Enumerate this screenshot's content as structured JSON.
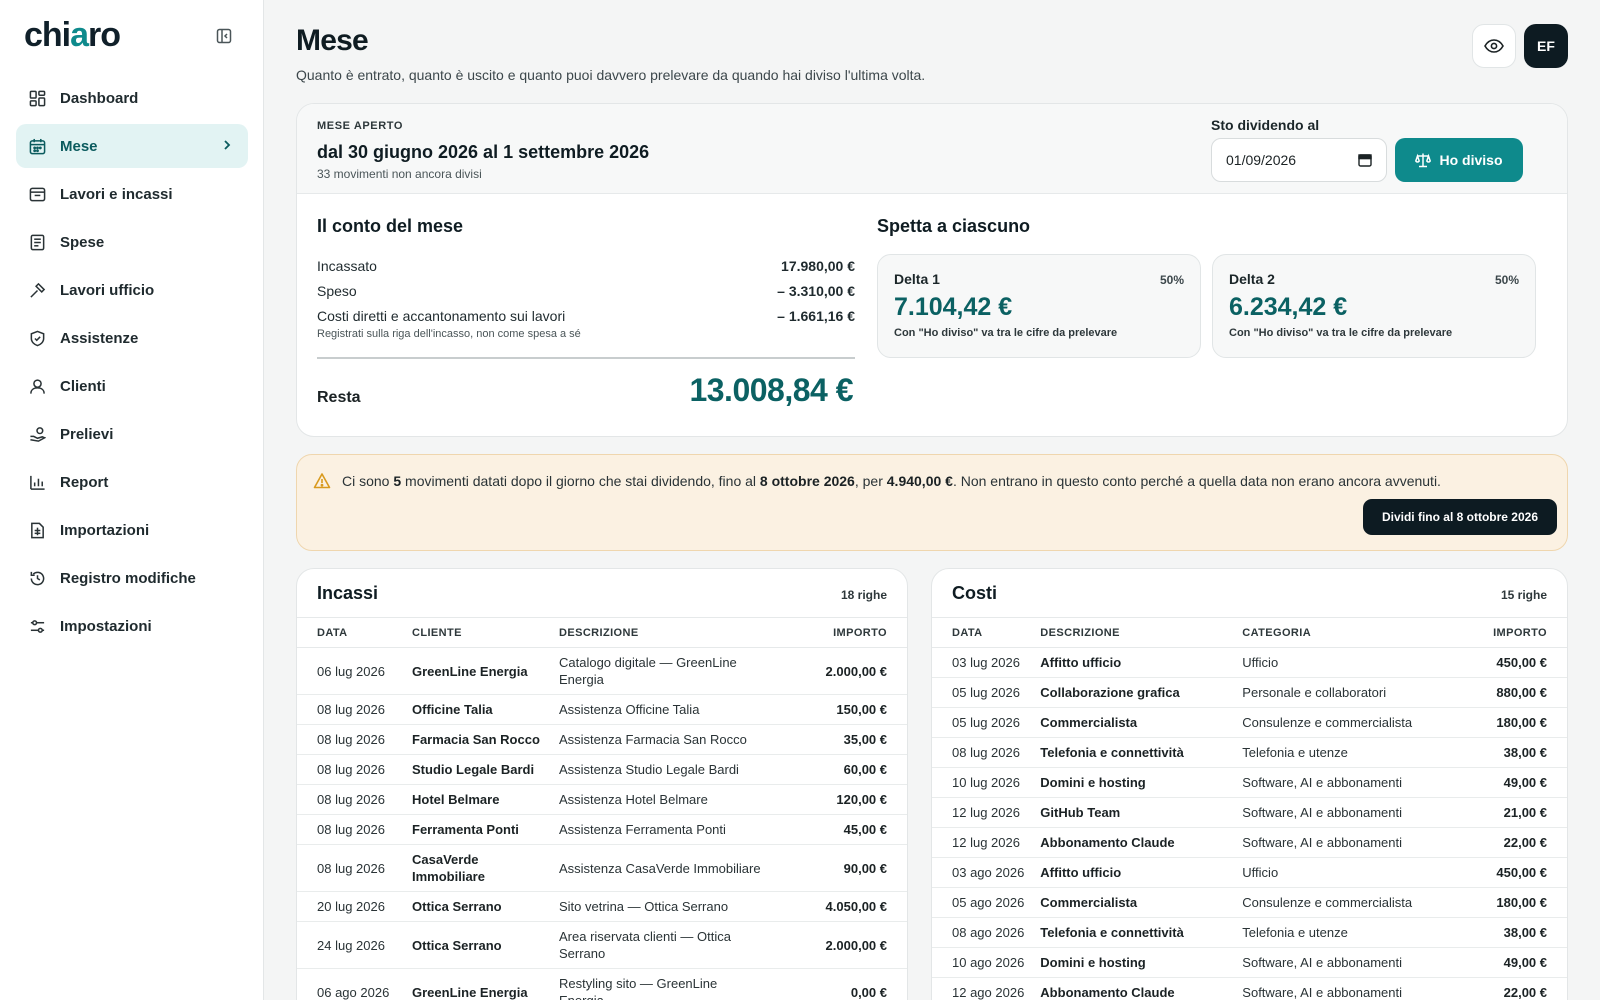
{
  "sidebar": {
    "logo_pre": "chi",
    "logo_accent": "a",
    "logo_post": "ro",
    "items": [
      {
        "label": "Dashboard",
        "icon": "dashboard-icon"
      },
      {
        "label": "Mese",
        "icon": "calendar-icon"
      },
      {
        "label": "Lavori e incassi",
        "icon": "inbox-icon"
      },
      {
        "label": "Spese",
        "icon": "receipt-icon"
      },
      {
        "label": "Lavori ufficio",
        "icon": "hammer-icon"
      },
      {
        "label": "Assistenze",
        "icon": "shield-icon"
      },
      {
        "label": "Clienti",
        "icon": "user-icon"
      },
      {
        "label": "Prelievi",
        "icon": "hand-coins-icon"
      },
      {
        "label": "Report",
        "icon": "bar-chart-icon"
      },
      {
        "label": "Importazioni",
        "icon": "file-import-icon"
      },
      {
        "label": "Registro modifiche",
        "icon": "history-icon"
      },
      {
        "label": "Impostazioni",
        "icon": "sliders-icon"
      }
    ]
  },
  "header": {
    "title": "Mese",
    "subtitle": "Quanto è entrato, quanto è uscito e quanto puoi davvero prelevare da quando hai diviso l'ultima volta.",
    "avatar": "EF"
  },
  "month": {
    "label": "MESE APERTO",
    "period": "dal 30 giugno 2026 al 1 settembre 2026",
    "count": "33 movimenti non ancora divisi",
    "split_label": "Sto dividendo al",
    "split_date": "01/09/2026",
    "divide_button": "Ho diviso"
  },
  "account": {
    "title": "Il conto del mese",
    "rows": [
      {
        "label": "Incassato",
        "value": "17.980,00 €"
      },
      {
        "label": "Speso",
        "value": "– 3.310,00 €"
      },
      {
        "label": "Costi diretti e accantonamento sui lavori",
        "value": "– 1.661,16 €"
      }
    ],
    "note": "Registrati sulla riga dell'incasso, non come spesa a sé",
    "rest_label": "Resta",
    "rest_value": "13.008,84 €"
  },
  "shares": {
    "title": "Spetta a ciascuno",
    "cards": [
      {
        "name": "Delta 1",
        "pct": "50%",
        "amount": "7.104,42 €",
        "note": "Con \"Ho diviso\" va tra le cifre da prelevare"
      },
      {
        "name": "Delta 2",
        "pct": "50%",
        "amount": "6.234,42 €",
        "note": "Con \"Ho diviso\" va tra le cifre da prelevare"
      }
    ]
  },
  "warning": {
    "t1": "Ci sono ",
    "b1": "5",
    "t2": " movimenti datati dopo il giorno che stai dividendo, fino al ",
    "b2": "8 ottobre 2026",
    "t3": ", per ",
    "b3": "4.940,00 €",
    "t4": ". Non entrano in questo conto perché a quella data non erano ancora avvenuti.",
    "button": "Dividi fino al 8 ottobre 2026"
  },
  "incassi": {
    "title": "Incassi",
    "count": "18 righe",
    "headers": [
      "DATA",
      "CLIENTE",
      "DESCRIZIONE",
      "IMPORTO"
    ],
    "rows": [
      [
        "06 lug 2026",
        "GreenLine Energia",
        "Catalogo digitale — GreenLine Energia",
        "2.000,00 €"
      ],
      [
        "08 lug 2026",
        "Officine Talia",
        "Assistenza Officine Talia",
        "150,00 €"
      ],
      [
        "08 lug 2026",
        "Farmacia San Rocco",
        "Assistenza Farmacia San Rocco",
        "35,00 €"
      ],
      [
        "08 lug 2026",
        "Studio Legale Bardi",
        "Assistenza Studio Legale Bardi",
        "60,00 €"
      ],
      [
        "08 lug 2026",
        "Hotel Belmare",
        "Assistenza Hotel Belmare",
        "120,00 €"
      ],
      [
        "08 lug 2026",
        "Ferramenta Ponti",
        "Assistenza Ferramenta Ponti",
        "45,00 €"
      ],
      [
        "08 lug 2026",
        "CasaVerde Immobiliare",
        "Assistenza CasaVerde Immobiliare",
        "90,00 €"
      ],
      [
        "20 lug 2026",
        "Ottica Serrano",
        "Sito vetrina — Ottica Serrano",
        "4.050,00 €"
      ],
      [
        "24 lug 2026",
        "Ottica Serrano",
        "Area riservata clienti — Ottica Serrano",
        "2.000,00 €"
      ],
      [
        "06 ago 2026",
        "GreenLine Energia",
        "Restyling sito — GreenLine Energia",
        "0,00 €"
      ]
    ]
  },
  "costi": {
    "title": "Costi",
    "count": "15 righe",
    "headers": [
      "DATA",
      "DESCRIZIONE",
      "CATEGORIA",
      "IMPORTO"
    ],
    "rows": [
      [
        "03 lug 2026",
        "Affitto ufficio",
        "Ufficio",
        "450,00 €"
      ],
      [
        "05 lug 2026",
        "Collaborazione grafica",
        "Personale e collaboratori",
        "880,00 €"
      ],
      [
        "05 lug 2026",
        "Commercialista",
        "Consulenze e commercialista",
        "180,00 €"
      ],
      [
        "08 lug 2026",
        "Telefonia e connettività",
        "Telefonia e utenze",
        "38,00 €"
      ],
      [
        "10 lug 2026",
        "Domini e hosting",
        "Software, AI e abbonamenti",
        "49,00 €"
      ],
      [
        "12 lug 2026",
        "GitHub Team",
        "Software, AI e abbonamenti",
        "21,00 €"
      ],
      [
        "12 lug 2026",
        "Abbonamento Claude",
        "Software, AI e abbonamenti",
        "22,00 €"
      ],
      [
        "03 ago 2026",
        "Affitto ufficio",
        "Ufficio",
        "450,00 €"
      ],
      [
        "05 ago 2026",
        "Commercialista",
        "Consulenze e commercialista",
        "180,00 €"
      ],
      [
        "08 ago 2026",
        "Telefonia e connettività",
        "Telefonia e utenze",
        "38,00 €"
      ],
      [
        "10 ago 2026",
        "Domini e hosting",
        "Software, AI e abbonamenti",
        "49,00 €"
      ],
      [
        "12 ago 2026",
        "Abbonamento Claude",
        "Software, AI e abbonamenti",
        "22,00 €"
      ]
    ]
  }
}
